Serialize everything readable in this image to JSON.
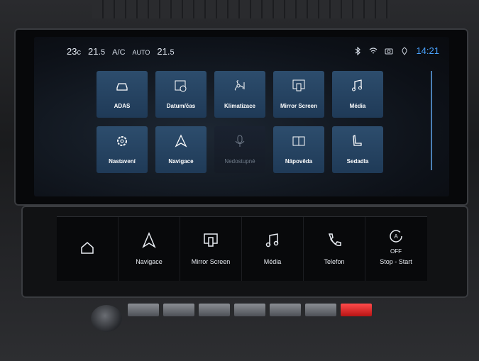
{
  "status_bar": {
    "temp_left": "23",
    "temp_left_unit": "c",
    "temp_set": "21.",
    "temp_set_dec": "5",
    "ac_label": "A/C",
    "auto_label": "AUTO",
    "temp_right": "21.",
    "temp_right_dec": "5",
    "time": "14:21",
    "icons": [
      "bluetooth-icon",
      "wifi-icon",
      "camera-icon",
      "location-icon"
    ]
  },
  "apps": [
    {
      "label": "ADAS",
      "icon": "car-icon",
      "enabled": true
    },
    {
      "label": "Datum/čas",
      "icon": "calendar-clock-icon",
      "enabled": true
    },
    {
      "label": "Klimatizace",
      "icon": "fan-icon",
      "enabled": true
    },
    {
      "label": "Mirror Screen",
      "icon": "mirror-screen-icon",
      "enabled": true
    },
    {
      "label": "Média",
      "icon": "music-note-icon",
      "enabled": true
    },
    {
      "label": "Nastavení",
      "icon": "gear-icon",
      "enabled": true
    },
    {
      "label": "Navigace",
      "icon": "navigation-arrow-icon",
      "enabled": true
    },
    {
      "label": "Nedostupné",
      "icon": "microphone-icon",
      "enabled": false
    },
    {
      "label": "Nápověda",
      "icon": "book-icon",
      "enabled": true
    },
    {
      "label": "Sedadla",
      "icon": "seat-icon",
      "enabled": true
    }
  ],
  "shortcuts": [
    {
      "label": "",
      "icon": "home-icon"
    },
    {
      "label": "Navigace",
      "icon": "navigation-arrow-icon"
    },
    {
      "label": "Mirror Screen",
      "icon": "mirror-screen-icon"
    },
    {
      "label": "Média",
      "icon": "music-note-icon"
    },
    {
      "label": "Telefon",
      "icon": "phone-icon"
    },
    {
      "label": "Stop - Start",
      "icon": "auto-stop-start-icon",
      "sub": "OFF"
    }
  ],
  "colors": {
    "accent": "#4aa3ff",
    "tile": "#24415f"
  }
}
